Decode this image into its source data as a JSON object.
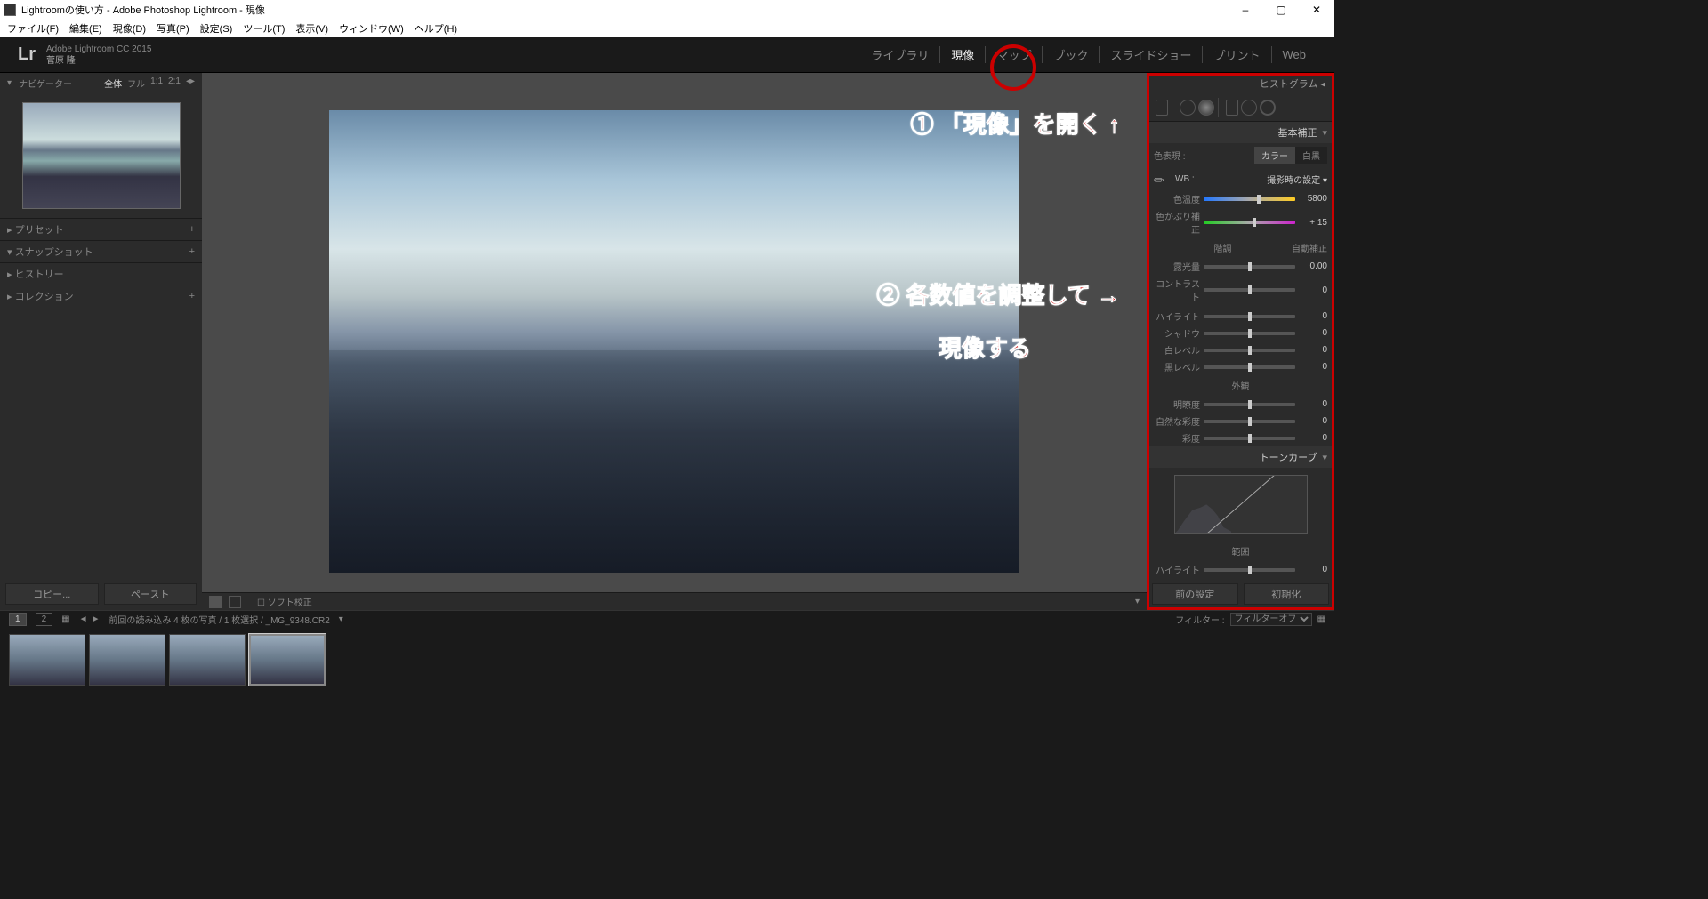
{
  "titlebar": {
    "text": "Lightroomの使い方 - Adobe Photoshop Lightroom - 現像"
  },
  "menubar": [
    "ファイル(F)",
    "編集(E)",
    "現像(D)",
    "写真(P)",
    "設定(S)",
    "ツール(T)",
    "表示(V)",
    "ウィンドウ(W)",
    "ヘルプ(H)"
  ],
  "appheader": {
    "product": "Adobe Lightroom CC 2015",
    "user": "菅原 隆"
  },
  "modules": [
    "ライブラリ",
    "現像",
    "マップ",
    "ブック",
    "スライドショー",
    "プリント",
    "Web"
  ],
  "active_module": "現像",
  "navigator": {
    "label": "ナビゲーター",
    "zoom_options": [
      "全体",
      "フル",
      "1:1",
      "2:1"
    ],
    "zoom_active": "全体"
  },
  "left_panels": [
    {
      "label": "プリセット",
      "plus": true
    },
    {
      "label": "スナップショット",
      "plus": true
    },
    {
      "label": "ヒストリー",
      "plus": false
    },
    {
      "label": "コレクション",
      "plus": true
    }
  ],
  "left_buttons": {
    "copy": "コピー...",
    "paste": "ペースト"
  },
  "sec_toolbar": {
    "soft": "ソフト校正"
  },
  "annotations": {
    "a1": "① 「現像」を開く ↑",
    "a2": "② 各数値を調整して →",
    "a3": "現像する"
  },
  "right": {
    "histogram": "ヒストグラム",
    "basic": "基本補正",
    "treatment_label": "色表現 :",
    "treatment_options": [
      "カラー",
      "白黒"
    ],
    "treatment_active": "カラー",
    "wb_label": "WB :",
    "wb_value": "撮影時の設定",
    "sliders_wb": [
      {
        "label": "色温度",
        "value": "5800"
      },
      {
        "label": "色かぶり補正",
        "value": "+ 15"
      }
    ],
    "tone_head": "階調",
    "tone_auto": "自動補正",
    "sliders_tone": [
      {
        "label": "露光量",
        "value": "0.00"
      },
      {
        "label": "コントラスト",
        "value": "0"
      }
    ],
    "sliders_tone2": [
      {
        "label": "ハイライト",
        "value": "0"
      },
      {
        "label": "シャドウ",
        "value": "0"
      },
      {
        "label": "白レベル",
        "value": "0"
      },
      {
        "label": "黒レベル",
        "value": "0"
      }
    ],
    "presence_head": "外観",
    "sliders_presence": [
      {
        "label": "明瞭度",
        "value": "0"
      },
      {
        "label": "自然な彩度",
        "value": "0"
      },
      {
        "label": "彩度",
        "value": "0"
      }
    ],
    "tonecurve": "トーンカーブ",
    "region": "範囲",
    "region_slider": {
      "label": "ハイライト",
      "value": "0"
    },
    "buttons": {
      "prev": "前の設定",
      "reset": "初期化"
    }
  },
  "filmstrip_head": {
    "info": "前回の読み込み   4 枚の写真 /  1 枚選択 /  _MG_9348.CR2",
    "filter_label": "フィルター :",
    "filter_value": "フィルターオフ"
  }
}
